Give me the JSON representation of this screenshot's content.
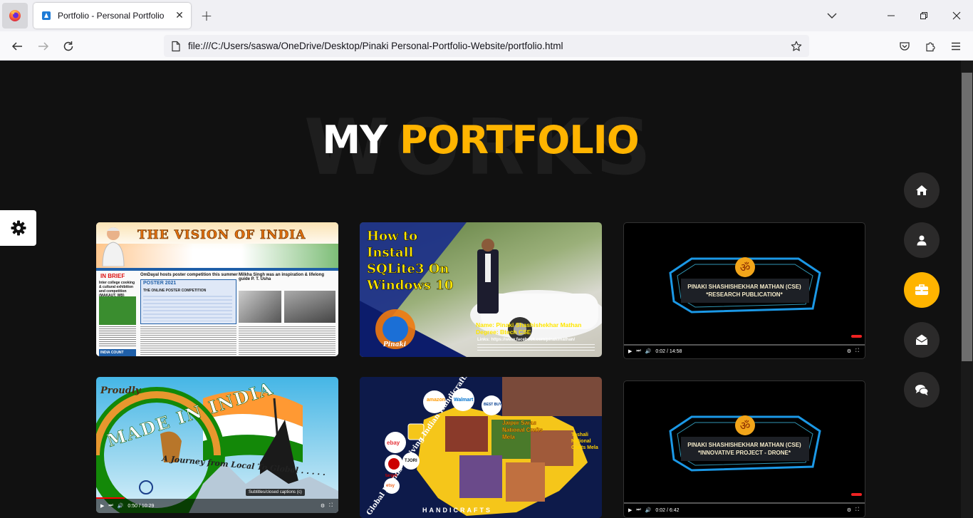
{
  "browser": {
    "tab_title": "Portfolio - Personal Portfolio",
    "tab_close": "✕",
    "new_tab": "+",
    "url": "file:///C:/Users/saswa/OneDrive/Desktop/Pinaki Personal-Portfolio-Website/portfolio.html",
    "controls": {
      "list_all_tabs": "⌄",
      "minimize": "—",
      "restore": "❐",
      "close": "✕"
    }
  },
  "page": {
    "background_word": "WORKS",
    "heading_white": "MY ",
    "heading_yellow": "PORTFOLIO",
    "accent_color": "#ffb400"
  },
  "side_nav": [
    {
      "icon": "home-icon",
      "active": false
    },
    {
      "icon": "user-icon",
      "active": false
    },
    {
      "icon": "briefcase-icon",
      "active": true
    },
    {
      "icon": "envelope-open-icon",
      "active": false
    },
    {
      "icon": "comments-icon",
      "active": false
    }
  ],
  "cards": {
    "news": {
      "masthead": "THE VISION OF INDIA",
      "section": "IN BRIEF",
      "headline1": "OmDayal hosts poster competition this summer",
      "headline2": "Milkha Singh was an inspiration & lifelong guide P. T. Usha",
      "poster": "POSTER 2021",
      "poster_sub": "THE ONLINE POSTER COMPETITION",
      "brief1": "Inter college cooking & cultural exhibition and competition (MAKAUT, WB)",
      "brief2": "INDIA COUNT"
    },
    "sqlite": {
      "title_l1": "How to",
      "title_l2": "Install",
      "title_l3": "SQLite3 On",
      "title_l4": "Windows 10",
      "name": "Name: Pinaki Shashishekhar Mathan",
      "degree": "Degree: Btech CSE",
      "links": "Links: https://www.facebook.com/pinakimathan/",
      "brand": "Pinaki"
    },
    "research": {
      "line1": "PINAKI SHASHISHEKHAR MATHAN (CSE)",
      "line2": "*RESEARCH PUBLICATION*",
      "time": "0:02 / 14:58"
    },
    "made_in_india": {
      "proudly": "Proudly",
      "title": "MADE IN INDIA",
      "tagline": "A Journey from Local To Global . . . . .",
      "tooltip": "Subtitles/closed captions (c)",
      "time": "0:50 / 10:29"
    },
    "handicrafts": {
      "arc_text": "Global Brands Reviving Indian Handicrafts",
      "jaipur": "Jaipur Saras National Crafts Mela",
      "toshali": "Toshali National Crafts Mela",
      "footer": "HANDICRAFTS",
      "brands": [
        "amazon",
        "Walmart",
        "BEST BUY",
        "ebay",
        "target",
        "TJORI",
        "etsy"
      ]
    },
    "drone": {
      "line1": "PINAKI SHASHISHEKHAR MATHAN (CSE)",
      "line2": "*INNOVATIVE PROJECT - DRONE*",
      "time": "0:02 / 6:42"
    }
  }
}
